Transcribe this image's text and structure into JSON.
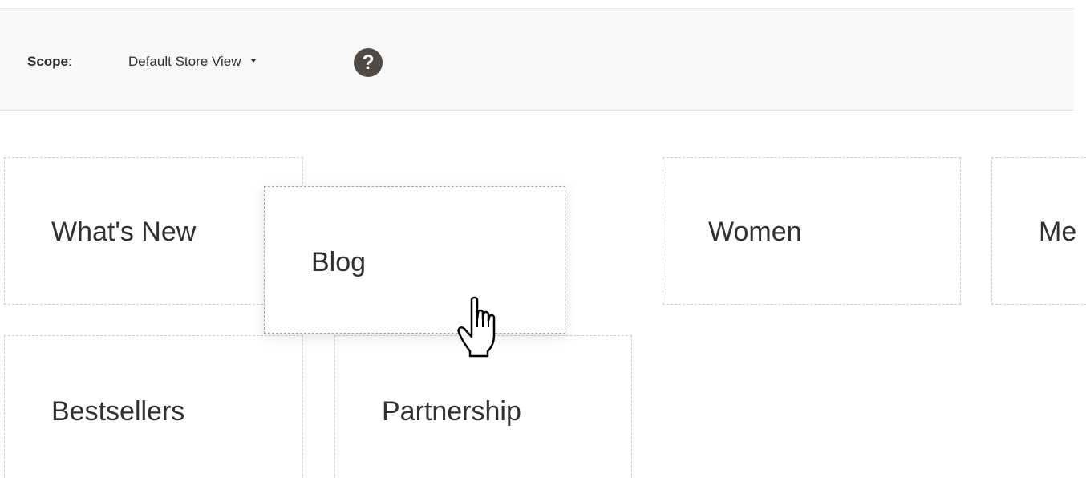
{
  "scope": {
    "label": "Scope",
    "colon": ":",
    "selected_view": "Default Store View",
    "help_icon_glyph": "?"
  },
  "menu_items": [
    {
      "label": "What's New"
    },
    {
      "label": "Blog"
    },
    {
      "label": "Women"
    },
    {
      "label": "Me"
    },
    {
      "label": "Bestsellers"
    },
    {
      "label": "Partnership"
    }
  ],
  "icons": {
    "help": "question-circle-icon",
    "dropdown": "caret-down-icon",
    "cursor": "hand-pointer-cursor-icon"
  },
  "colors": {
    "scope_bar_bg": "#f8f8f8",
    "help_icon_bg": "#514943",
    "text": "#303030",
    "dashed_border": "#cfcfcf"
  }
}
